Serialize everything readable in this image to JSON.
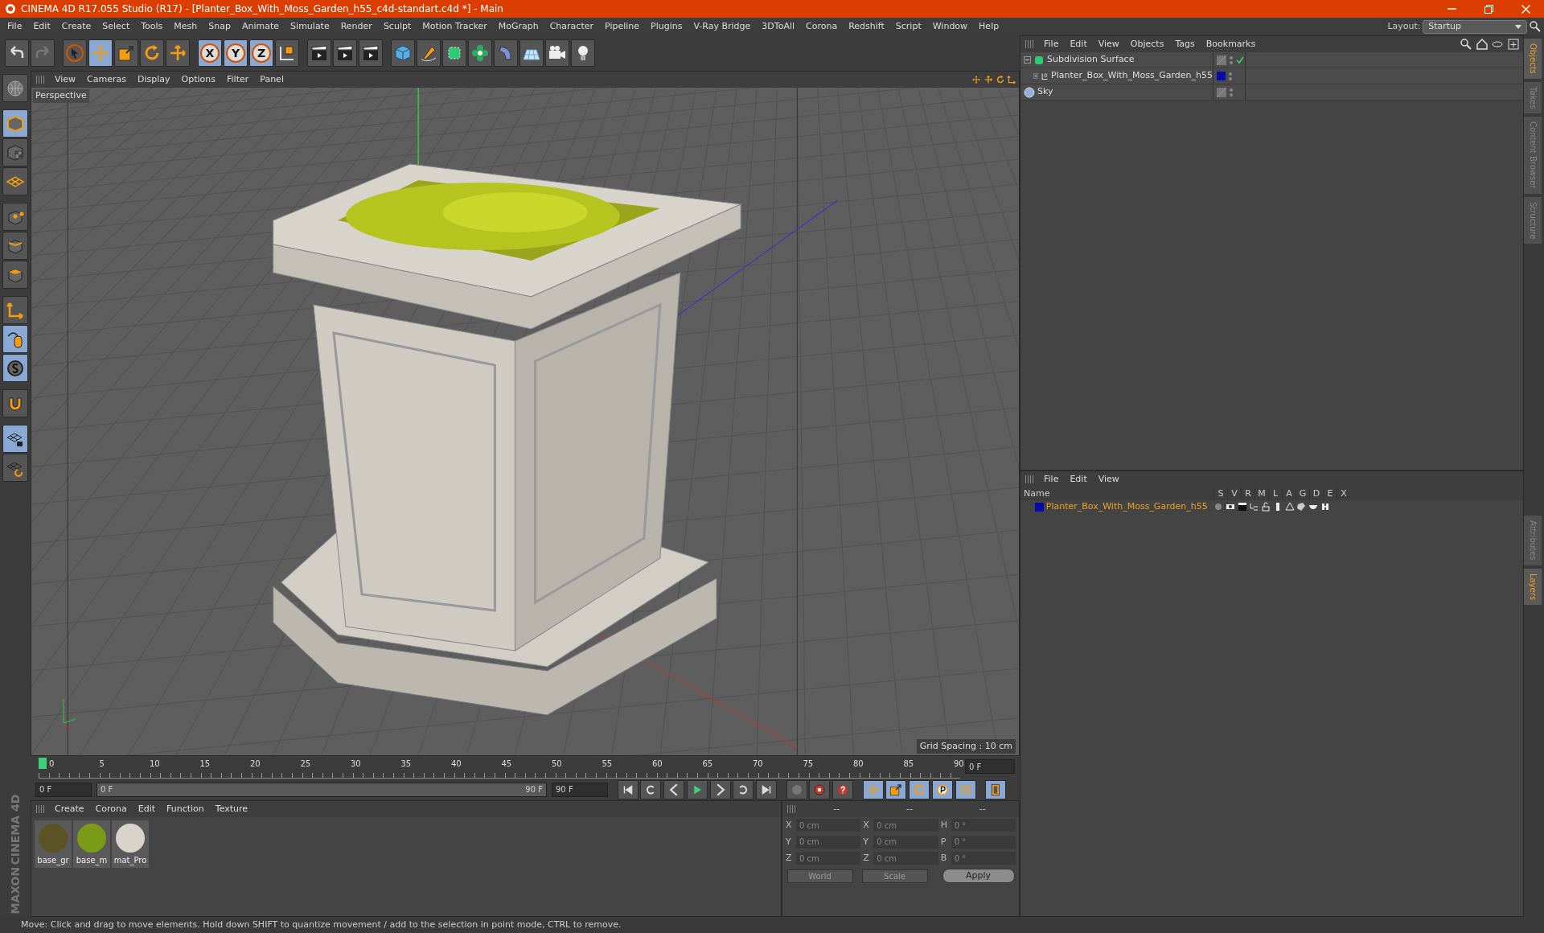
{
  "window": {
    "title": "CINEMA 4D R17.055 Studio (R17) - [Planter_Box_With_Moss_Garden_h55_c4d-standart.c4d *] - Main"
  },
  "menu": [
    "File",
    "Edit",
    "Create",
    "Select",
    "Tools",
    "Mesh",
    "Snap",
    "Animate",
    "Simulate",
    "Render",
    "Sculpt",
    "Motion Tracker",
    "MoGraph",
    "Character",
    "Pipeline",
    "Plugins",
    "V-Ray Bridge",
    "3DToAll",
    "Corona",
    "Redshift",
    "Script",
    "Window",
    "Help"
  ],
  "layout": {
    "label": "Layout:",
    "value": "Startup"
  },
  "toolbar": [
    {
      "kind": "undo",
      "active": false
    },
    {
      "kind": "redo",
      "active": false
    },
    {
      "kind": "sep"
    },
    {
      "kind": "pointer",
      "active": false
    },
    {
      "kind": "move",
      "active": true
    },
    {
      "kind": "scale",
      "active": false
    },
    {
      "kind": "rotate",
      "active": false
    },
    {
      "kind": "cross",
      "active": false
    },
    {
      "kind": "sep"
    },
    {
      "kind": "axis",
      "label": "X",
      "active": true
    },
    {
      "kind": "axis",
      "label": "Y",
      "active": true
    },
    {
      "kind": "axis",
      "label": "Z",
      "active": true
    },
    {
      "kind": "coord",
      "active": false
    },
    {
      "kind": "sep"
    },
    {
      "kind": "clapper",
      "active": false
    },
    {
      "kind": "clapper",
      "active": false
    },
    {
      "kind": "clapper",
      "active": false
    },
    {
      "kind": "sep"
    },
    {
      "kind": "cube",
      "active": false
    },
    {
      "kind": "pen",
      "active": false
    },
    {
      "kind": "subdiv",
      "active": false
    },
    {
      "kind": "flower",
      "active": false
    },
    {
      "kind": "bend",
      "active": false
    },
    {
      "kind": "floor",
      "active": false
    },
    {
      "kind": "camera",
      "active": false
    },
    {
      "kind": "bulb",
      "active": false
    }
  ],
  "left_tools": [
    {
      "kind": "globe",
      "active": false
    },
    {
      "kind": "sep"
    },
    {
      "kind": "model",
      "active": true
    },
    {
      "kind": "texture",
      "active": false
    },
    {
      "kind": "grid",
      "active": false
    },
    {
      "kind": "sep"
    },
    {
      "kind": "points",
      "active": false
    },
    {
      "kind": "edges",
      "active": false
    },
    {
      "kind": "faces",
      "active": false
    },
    {
      "kind": "sep"
    },
    {
      "kind": "corner",
      "active": false
    },
    {
      "kind": "mouse",
      "active": true
    },
    {
      "kind": "snap",
      "active": true
    },
    {
      "kind": "sep"
    },
    {
      "kind": "magnet",
      "active": false
    },
    {
      "kind": "sep"
    },
    {
      "kind": "gridlock",
      "active": true
    },
    {
      "kind": "gridrot",
      "active": false
    }
  ],
  "brand": [
    "MAXON",
    "CINEMA 4D"
  ],
  "viewport": {
    "menu": [
      "View",
      "Cameras",
      "Display",
      "Options",
      "Filter",
      "Panel"
    ],
    "label": "Perspective",
    "grid_spacing": "Grid Spacing : 10 cm"
  },
  "timeline": {
    "ticks": [
      "0",
      "5",
      "10",
      "15",
      "20",
      "25",
      "30",
      "35",
      "40",
      "45",
      "50",
      "55",
      "60",
      "65",
      "70",
      "75",
      "80",
      "85",
      "90"
    ],
    "current_frame": "0 F",
    "start": "0 F",
    "range_start": "0 F",
    "range_end": "90 F",
    "end": "90 F",
    "range": {
      "level": 1
    },
    "controls": [
      {
        "kind": "first"
      },
      {
        "kind": "prevkey"
      },
      {
        "kind": "stepback"
      },
      {
        "kind": "play"
      },
      {
        "kind": "stepfwd"
      },
      {
        "kind": "nextkey"
      },
      {
        "kind": "last"
      },
      {
        "kind": "sep"
      },
      {
        "kind": "keyoff"
      },
      {
        "kind": "record"
      },
      {
        "kind": "help"
      },
      {
        "kind": "sep"
      },
      {
        "kind": "move"
      },
      {
        "kind": "scale"
      },
      {
        "kind": "rotate"
      },
      {
        "kind": "param"
      },
      {
        "kind": "dots"
      },
      {
        "kind": "sep"
      },
      {
        "kind": "film"
      }
    ]
  },
  "materials": {
    "menu": [
      "Create",
      "Corona",
      "Edit",
      "Function",
      "Texture"
    ],
    "items": [
      {
        "name": "base_gr",
        "color": "#5a5424"
      },
      {
        "name": "base_m",
        "color": "#7a9a18"
      },
      {
        "name": "mat_Pro",
        "color": "#d8d4cc"
      }
    ]
  },
  "coordinates": {
    "headers": [
      "--",
      "--",
      "--"
    ],
    "rows": [
      {
        "label_1": "X",
        "value_1": "0 cm",
        "label_2": "X",
        "value_2": "0 cm",
        "label_3": "H",
        "value_3": "0 °"
      },
      {
        "label_1": "Y",
        "value_1": "0 cm",
        "label_2": "Y",
        "value_2": "0 cm",
        "label_3": "P",
        "value_3": "0 °"
      },
      {
        "label_1": "Z",
        "value_1": "0 cm",
        "label_2": "Z",
        "value_2": "0 cm",
        "label_3": "B",
        "value_3": "0 °"
      }
    ],
    "mode": "World",
    "transform": "Scale",
    "apply": "Apply"
  },
  "objects": {
    "menu": [
      "File",
      "Edit",
      "View",
      "Objects",
      "Tags",
      "Bookmarks"
    ],
    "tree": [
      {
        "name": "Subdivision Surface",
        "kind": "subdiv",
        "expanded": true,
        "enabled": true,
        "children": [
          {
            "name": "Planter_Box_With_Moss_Garden_h55",
            "kind": "null",
            "expanded": false,
            "color": "#0a0aa8",
            "enabled": false
          }
        ]
      },
      {
        "name": "Sky",
        "kind": "sky",
        "enabled": false
      }
    ]
  },
  "layers": {
    "menu": [
      "File",
      "Edit",
      "View"
    ],
    "columns": [
      "Name",
      "S",
      "V",
      "R",
      "M",
      "L",
      "A",
      "G",
      "D",
      "E",
      "X"
    ],
    "rows": [
      {
        "name": "Planter_Box_With_Moss_Garden_h55",
        "color": "#0a0aa8"
      }
    ]
  },
  "side_tabs_top": [
    {
      "label": "Objects",
      "selected": true
    },
    {
      "label": "Takes",
      "selected": false
    },
    {
      "label": "Content Browser",
      "selected": false
    },
    {
      "label": "Structure",
      "selected": false
    }
  ],
  "side_tabs_bottom": [
    {
      "label": "Attributes",
      "selected": false
    },
    {
      "label": "Layers",
      "selected": true
    }
  ],
  "status_bar": "Move: Click and drag to move elements. Hold down SHIFT to quantize movement / add to the selection in point mode, CTRL to remove."
}
